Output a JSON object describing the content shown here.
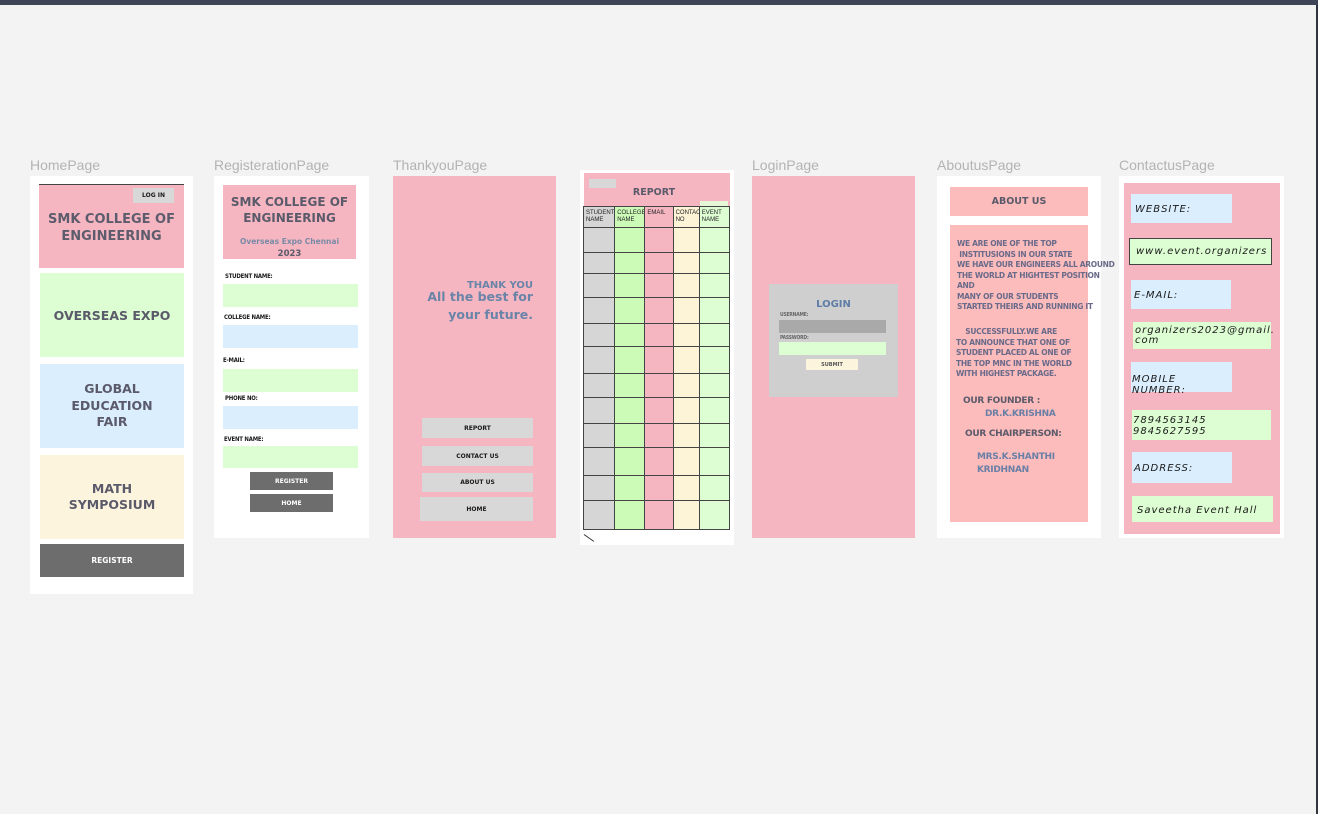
{
  "frames": {
    "home": "HomePage",
    "register": "RegisterationPage",
    "thankyou": "ThankyouPage",
    "login": "LoginPage",
    "about": "AboutusPage",
    "contact": "ContactusPage"
  },
  "home": {
    "login_button": "LOG IN",
    "college": "SMK COLLEGE OF\nENGINEERING",
    "cards": [
      "OVERSEAS EXPO",
      "GLOBAL\nEDUCATION\nFAIR",
      "MATH\nSYMPOSIUM"
    ],
    "register_button": "REGISTER"
  },
  "register": {
    "college": "SMK COLLEGE OF\nENGINEERING",
    "subtitle": "Overseas Expo Chennai",
    "year": "2023",
    "fields": [
      "STUDENT NAME:",
      "COLLEGE NAME:",
      "E-MAIL:",
      "PHONE NO:",
      "EVENT NAME:"
    ],
    "register_button": "REGISTER",
    "home_button": "HOME"
  },
  "thankyou": {
    "line1": "THANK YOU",
    "line2": "All the best for\nyour future.",
    "buttons": [
      "REPORT",
      "CONTACT US",
      "ABOUT US",
      "HOME"
    ]
  },
  "report": {
    "title": "REPORT",
    "headers": [
      "STUDENT NAME",
      "COLLEGE NAME",
      "EMAIL",
      "CONTAC NO",
      "EVENT NAME"
    ],
    "column_colors": [
      "#d6d6d6",
      "#ccfbb8",
      "#f5b6c1",
      "#fdf3d6",
      "#ddfdd2"
    ]
  },
  "login": {
    "title": "LOGIN",
    "username_label": "USERNAME:",
    "password_label": "PASSWORD:",
    "submit": "SUBMIT"
  },
  "about": {
    "title": "ABOUT US",
    "para1": "WE ARE ONE OF THE TOP\n INSTITUSIONS IN OUR STATE\nWE HAVE OUR ENGINEERS ALL AROUND\nTHE WORLD AT HIGHTEST POSITION\nAND\nMANY OF OUR STUDENTS\nSTARTED THEIRS AND RUNNING IT",
    "para2": "    SUCCESSFULLY.WE ARE\nTO ANNOUNCE THAT ONE OF\nSTUDENT PLACED AL ONE OF\nTHE TOP MNC IN THE WORLD\nWITH HIGHEST PACKAGE.",
    "founder_label": "OUR FOUNDER :",
    "founder_name": "DR.K.KRISHNA",
    "chair_label": "OUR CHAIRPERSON:",
    "chair_name": "MRS.K.SHANTHI\nKRIDHNAN"
  },
  "contact": {
    "website_label": "WEBSITE:",
    "website_value": "www.event.organizers",
    "email_label": "E-MAIL:",
    "email_value": "organizers2023@gmail.\ncom",
    "mobile_label": "MOBILE NUMBER:",
    "mobile_value": "7894563145\n9845627595",
    "address_label": "ADDRESS:",
    "address_value": "Saveetha Event Hall"
  }
}
